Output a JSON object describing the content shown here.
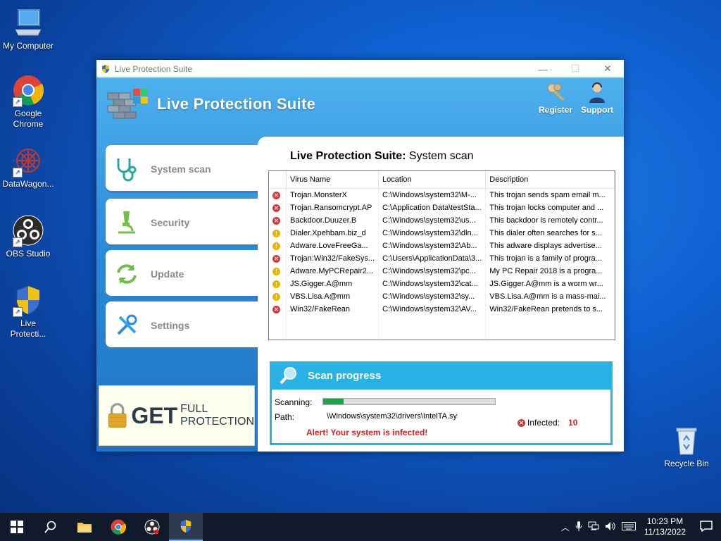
{
  "desktop": {
    "icons": [
      {
        "label": "My Computer"
      },
      {
        "label": "Google Chrome"
      },
      {
        "label": "DataWagon..."
      },
      {
        "label": "OBS Studio"
      },
      {
        "label": "Live Protecti..."
      },
      {
        "label": "Recycle Bin"
      }
    ]
  },
  "window": {
    "title": "Live Protection Suite",
    "brand": "Live Protection Suite",
    "top_buttons": {
      "register": "Register",
      "support": "Support"
    },
    "nav": [
      {
        "label": "System scan",
        "icon": "stethoscope-icon"
      },
      {
        "label": "Security",
        "icon": "microscope-icon"
      },
      {
        "label": "Update",
        "icon": "refresh-icon"
      },
      {
        "label": "Settings",
        "icon": "tools-icon"
      }
    ],
    "promo": {
      "get": "GET",
      "line1": "FULL",
      "line2": "PROTECTION"
    },
    "panel": {
      "title_bold": "Live Protection Suite:",
      "title_rest": " System scan",
      "columns": [
        "Virus Name",
        "Location",
        "Description"
      ],
      "rows": [
        {
          "status": "critical",
          "name": "Trojan.MonsterX",
          "location": "C:\\Windows\\system32\\M-...",
          "description": "This trojan sends spam email m..."
        },
        {
          "status": "critical",
          "name": "Trojan.Ransomcrypt.AP",
          "location": "C:\\Application Data\\testSta...",
          "description": "This trojan locks computer and ..."
        },
        {
          "status": "critical",
          "name": "Backdoor.Duuzer.B",
          "location": "C:\\Windows\\system32\\us...",
          "description": "This backdoor is remotely contr..."
        },
        {
          "status": "warning",
          "name": "Dialer.Xpehbam.biz_d",
          "location": "C:\\Windows\\system32\\dln...",
          "description": "This dialer often searches for s..."
        },
        {
          "status": "warning",
          "name": "Adware.LoveFreeGa...",
          "location": "C:\\Windows\\system32\\Ab...",
          "description": "This adware displays advertise..."
        },
        {
          "status": "critical",
          "name": "Trojan:Win32/FakeSys...",
          "location": "C:\\Users\\ApplicationData\\3...",
          "description": "This trojan is a family of progra..."
        },
        {
          "status": "warning",
          "name": "Adware.MyPCRepair2...",
          "location": "C:\\Windows\\system32\\pc...",
          "description": "My PC Repair 2018 is a progra..."
        },
        {
          "status": "warning",
          "name": "JS.Gigger.A@mm",
          "location": "C:\\Windows\\system32\\cat...",
          "description": "JS.Gigger.A@mm is a worm wr..."
        },
        {
          "status": "warning",
          "name": "VBS.Lisa.A@mm",
          "location": "C:\\Windows\\system32\\sy...",
          "description": "VBS.Lisa.A@mm is a mass-mai..."
        },
        {
          "status": "critical",
          "name": "Win32/FakeRean",
          "location": "C:\\Windows\\system32\\AV...",
          "description": "Win32/FakeRean pretends to s..."
        }
      ]
    },
    "scan": {
      "header": "Scan progress",
      "scanning_label": "Scanning:",
      "progress_fraction": 0.12,
      "path_label": "Path:",
      "path_value": "\\Windows\\system32\\drivers\\IntelTA.sys",
      "infected_label": "Infected:",
      "infected_count": "10",
      "alert": "Alert! Your system is infected!"
    }
  },
  "taskbar": {
    "time": "10:23 PM",
    "date": "11/13/2022"
  },
  "colors": {
    "critical": "#d43a3a",
    "warning": "#e8b400",
    "alert": "#d42020",
    "accent": "#29b2e6"
  }
}
